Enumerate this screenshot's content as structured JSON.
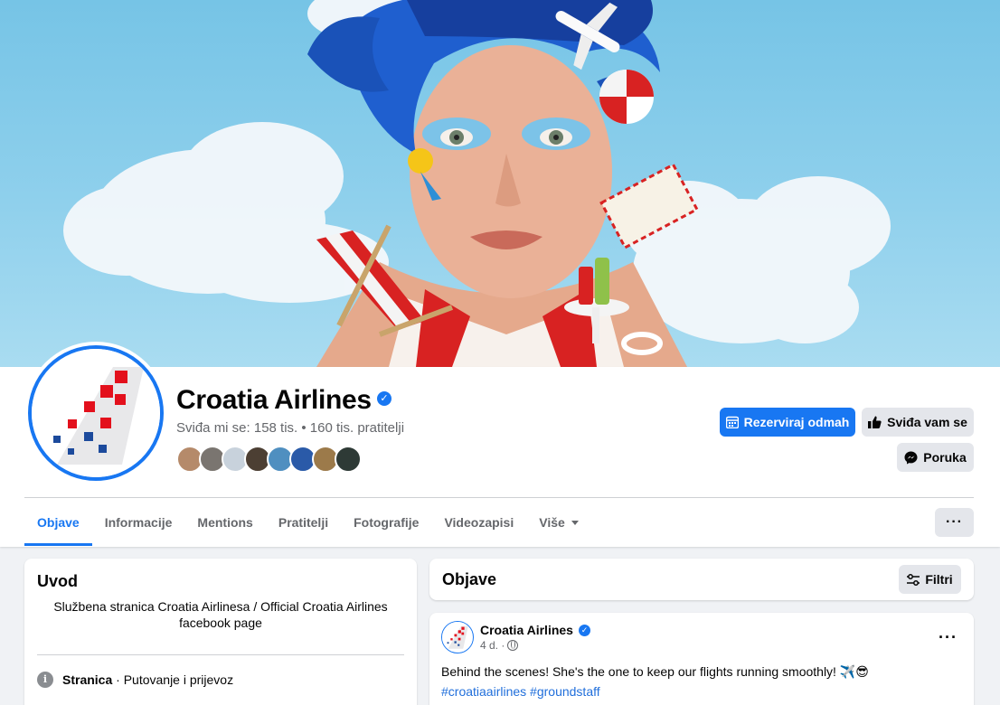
{
  "page": {
    "name": "Croatia Airlines",
    "stats": "Sviđa mi se: 158 tis. • 160 tis. pratitelji"
  },
  "buttons": {
    "book": "Rezerviraj odmah",
    "like": "Sviđa vam se",
    "message": "Poruka",
    "more": "···"
  },
  "tabs": [
    {
      "label": "Objave",
      "active": true
    },
    {
      "label": "Informacije"
    },
    {
      "label": "Mentions"
    },
    {
      "label": "Pratitelji"
    },
    {
      "label": "Fotografije"
    },
    {
      "label": "Videozapisi"
    },
    {
      "label": "Više"
    }
  ],
  "intro": {
    "title": "Uvod",
    "description": "Službena stranica Croatia Airlinesa / Official Croatia Airlines facebook page",
    "category_label": "Stranica",
    "category_value": " · Putovanje i prijevoz"
  },
  "posts_section": {
    "title": "Objave",
    "filter_label": "Filtri"
  },
  "post": {
    "author": "Croatia Airlines",
    "time": "4 d. ·",
    "text": "Behind the scenes! She's the one to keep our flights running smoothly! ✈️😎",
    "hashtags": "#croatiaairlines #groundstaff"
  },
  "colors": {
    "accent": "#1877f2",
    "brand_red": "#e3101c",
    "brand_blue": "#1c4a9c"
  }
}
